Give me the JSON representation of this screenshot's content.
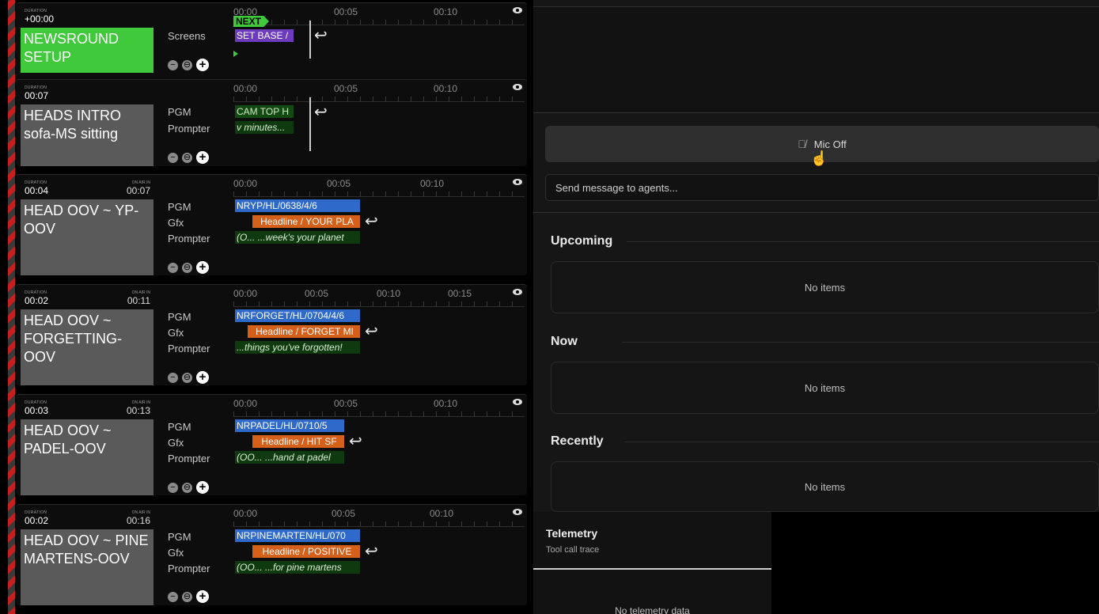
{
  "rundown": {
    "duration_label": "DURATION",
    "on_air_label": "ON AIR IN",
    "tick_labels": [
      "00:00",
      "00:05",
      "00:10",
      "00:15"
    ],
    "segments": [
      {
        "duration": "+00:00",
        "on_air_in": "",
        "title": "NEWSROUND SETUP",
        "layers": [
          "Screens"
        ],
        "pieces": {
          "next": "NEXT",
          "p1": "SET BASE /"
        }
      },
      {
        "duration": "00:07",
        "on_air_in": "",
        "title": "HEADS INTRO sofa-MS sitting",
        "layers": [
          "PGM",
          "Prompter"
        ],
        "pieces": {
          "p1": "CAM TOP H",
          "p2": "v minutes..."
        }
      },
      {
        "duration": "00:04",
        "on_air_in": "00:07",
        "title": "HEAD OOV ~ YP-OOV",
        "layers": [
          "PGM",
          "Gfx",
          "Prompter"
        ],
        "pieces": {
          "p1": "NRYP/HL/0638/4/6",
          "p2": "Headline / YOUR PLA",
          "p3": "(O...  ...week's your planet"
        }
      },
      {
        "duration": "00:02",
        "on_air_in": "00:11",
        "title": "HEAD OOV ~ FORGETTING-OOV",
        "layers": [
          "PGM",
          "Gfx",
          "Prompter"
        ],
        "pieces": {
          "p1": "NRFORGET/HL/0704/4/6",
          "p2": "Headline / FORGET MI",
          "p3": "...things you've forgotten!"
        }
      },
      {
        "duration": "00:03",
        "on_air_in": "00:13",
        "title": "HEAD OOV ~ PADEL-OOV",
        "layers": [
          "PGM",
          "Gfx",
          "Prompter"
        ],
        "pieces": {
          "p1": "NRPADEL/HL/0710/5",
          "p2": "Headline / HIT SF",
          "p3": "(OO...  ...hand at padel"
        }
      },
      {
        "duration": "00:02",
        "on_air_in": "00:16",
        "title": "HEAD OOV ~ PINE MARTENS-OOV",
        "layers": [
          "PGM",
          "Gfx",
          "Prompter"
        ],
        "pieces": {
          "p1": "NRPINEMARTEN/HL/070",
          "p2": "Headline / POSITIVE",
          "p3": "(OO...  ...for pine martens"
        }
      }
    ]
  },
  "panel": {
    "mic_button": "Mic Off",
    "message_placeholder": "Send message to agents...",
    "sections": {
      "upcoming": {
        "title": "Upcoming",
        "empty": "No items"
      },
      "now": {
        "title": "Now",
        "empty": "No items"
      },
      "recently": {
        "title": "Recently",
        "empty": "No items"
      }
    },
    "telemetry": {
      "title": "Telemetry",
      "subtitle": "Tool call trace",
      "empty": "No telemetry data"
    }
  },
  "colors": {
    "accent_green": "#3fc93b",
    "pgm_blue": "#2f69c9",
    "gfx_orange": "#d4601a",
    "screens_purple": "#6d3bbd",
    "stripe_red": "#c81e1e"
  }
}
